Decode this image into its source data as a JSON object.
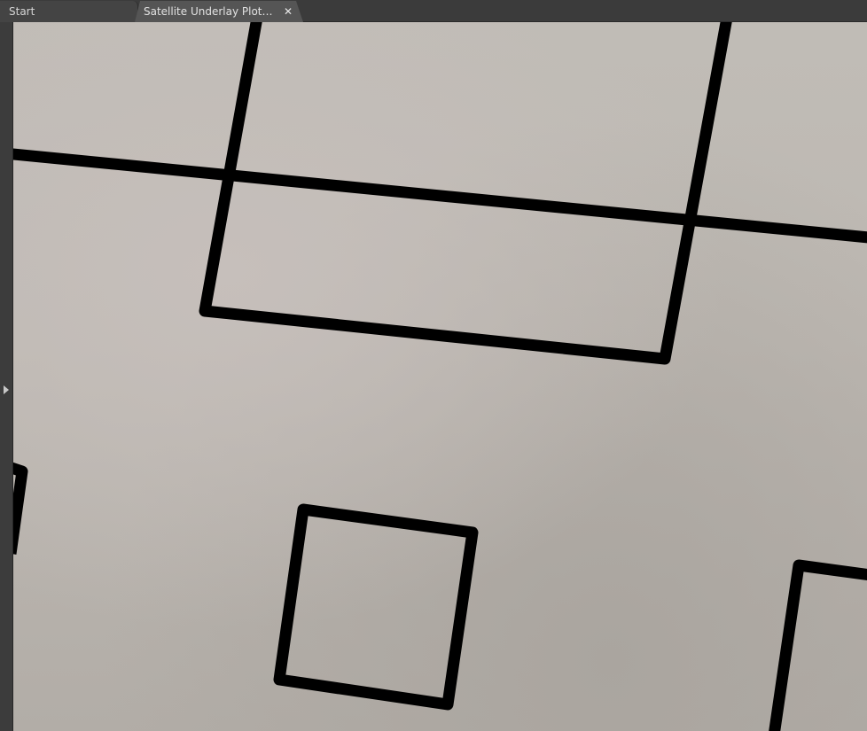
{
  "tabs": [
    {
      "label": "Start",
      "active": false
    },
    {
      "label": "Satellite Underlay Plot Generator",
      "active": true
    }
  ],
  "icons": {
    "close": "close-icon",
    "panel_toggle": "triangle-right-icon"
  },
  "colors": {
    "tab_bar": "#3b3b3b",
    "active_tab": "#555555",
    "canvas": "#bdb8b2",
    "outline": "#000000"
  }
}
